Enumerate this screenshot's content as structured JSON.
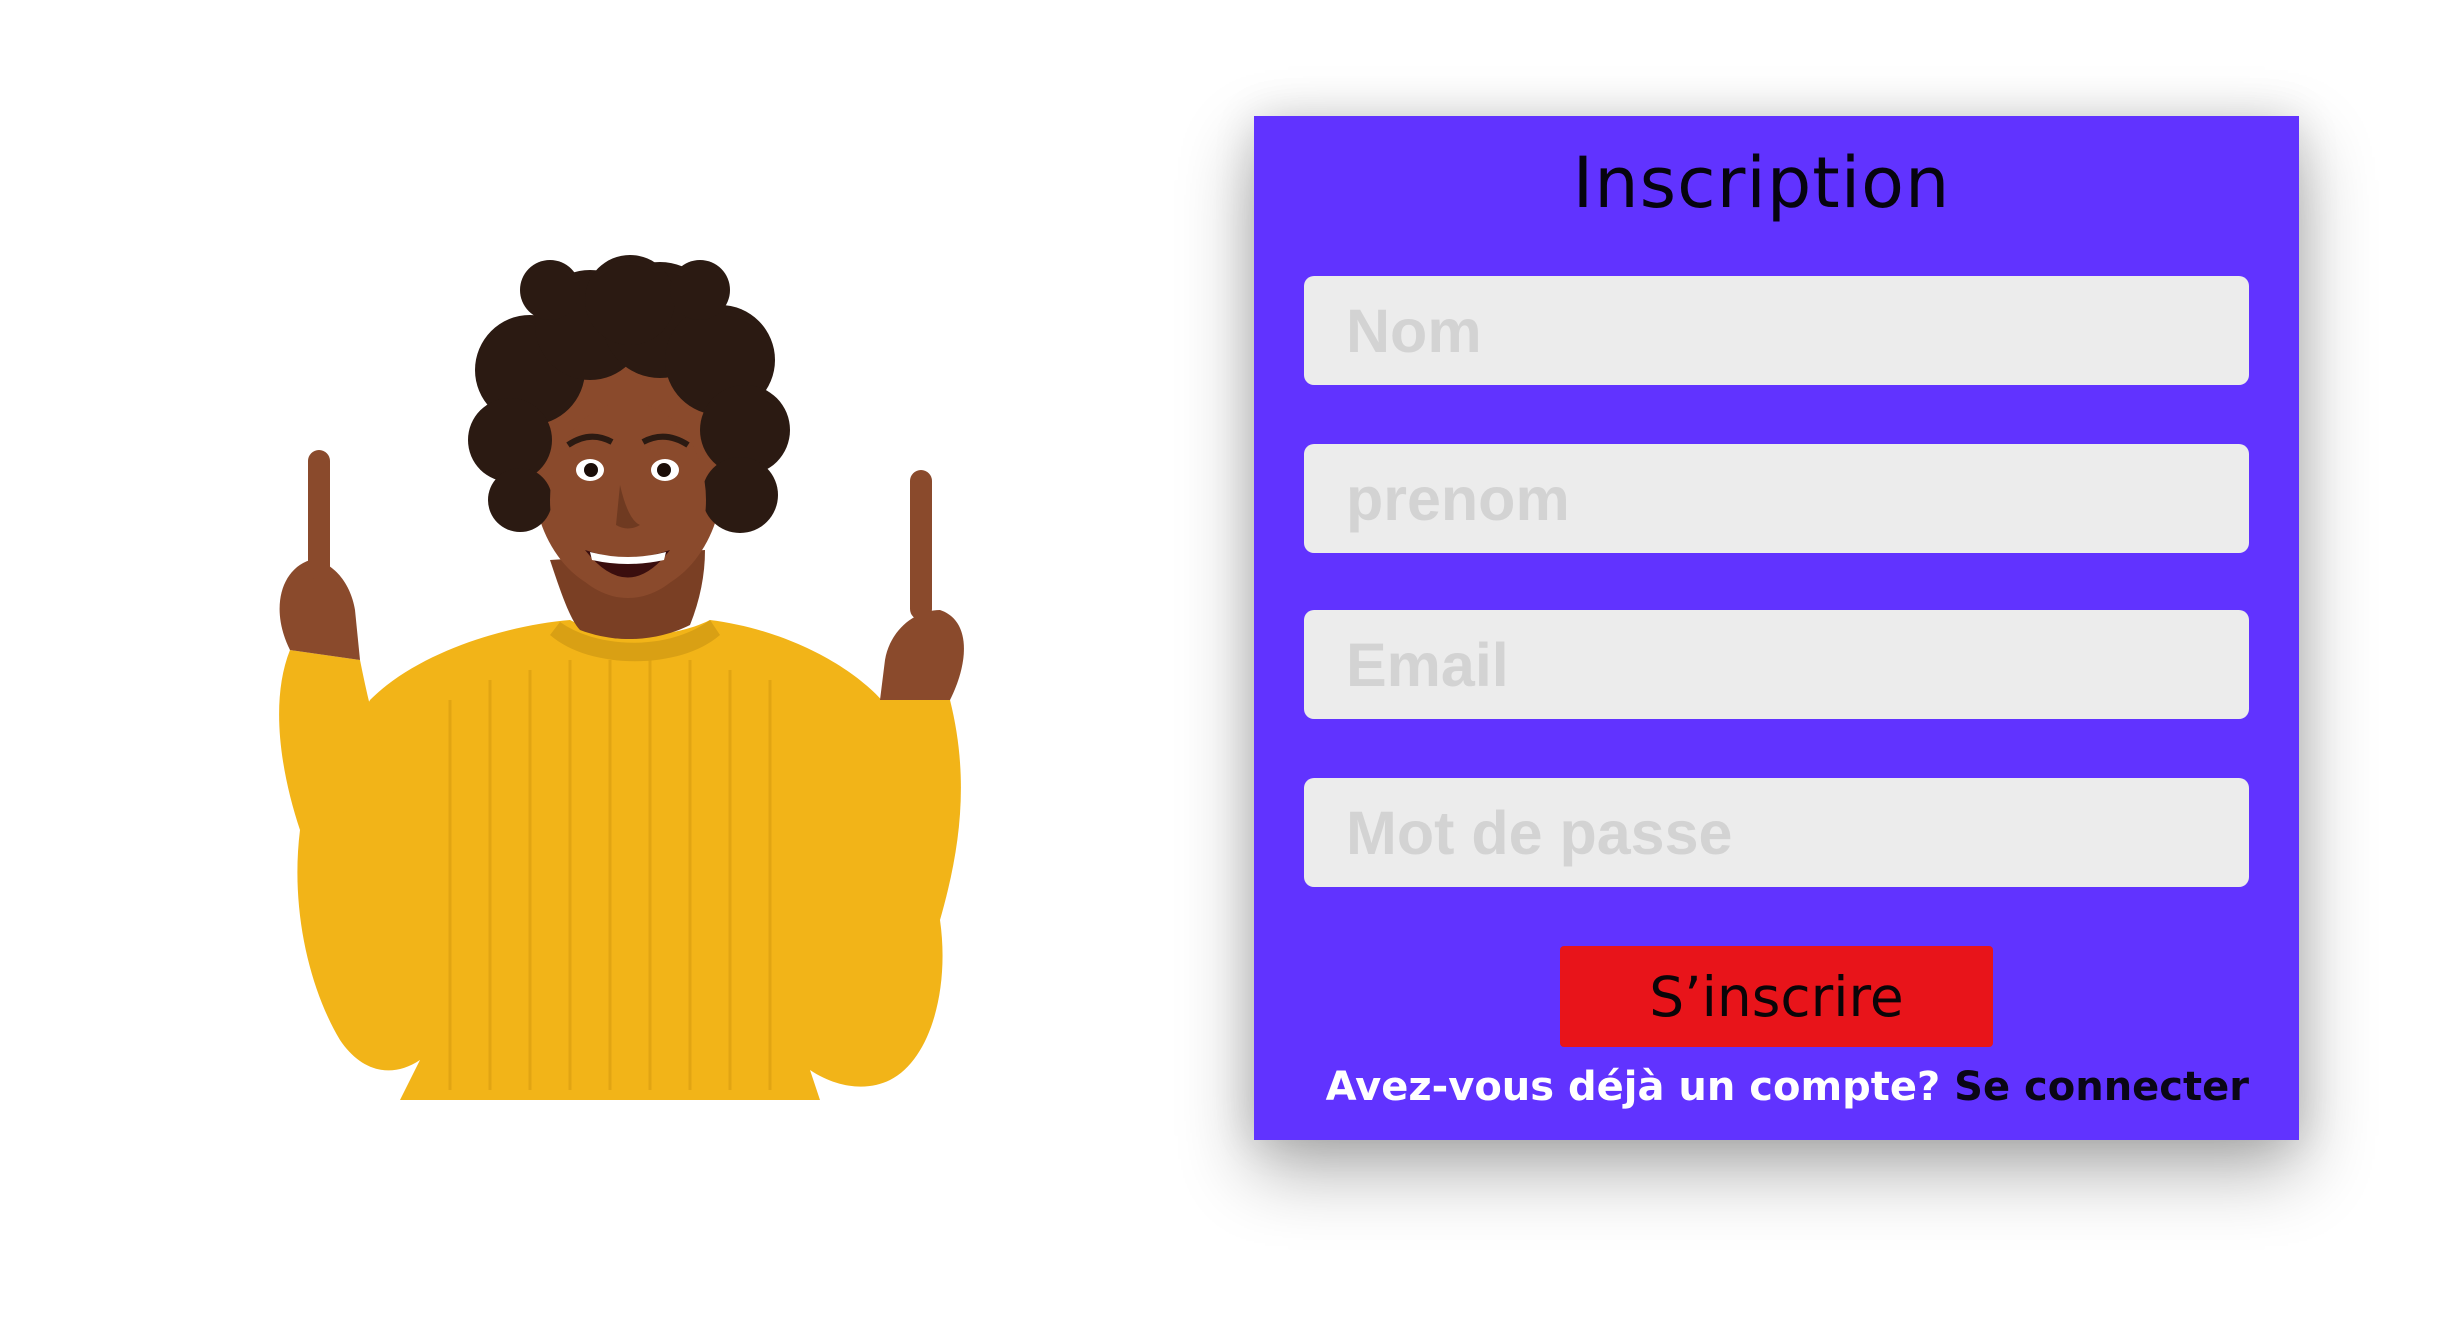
{
  "illustration": {
    "description_icon": "person-pointing-up-image",
    "colors": {
      "sweater": "#f2b418",
      "skin": "#8a4a2c",
      "hair": "#2b1a12"
    }
  },
  "signup_form": {
    "title": "Inscription",
    "fields": [
      {
        "name": "nom",
        "placeholder": "Nom",
        "value": ""
      },
      {
        "name": "prenom",
        "placeholder": "prenom",
        "value": ""
      },
      {
        "name": "email",
        "placeholder": "Email",
        "value": ""
      },
      {
        "name": "mot_de_passe",
        "placeholder": "Mot de passe",
        "value": ""
      }
    ],
    "submit_label": "S’inscrire",
    "login_prompt": "Avez-vous déjà un compte?",
    "login_link_label": "Se connecter",
    "colors": {
      "card_background": "#6133ff",
      "field_background": "#ececec",
      "placeholder": "#d3d3d3",
      "submit_background": "#e8141a",
      "prompt_text": "#ffffff"
    }
  }
}
